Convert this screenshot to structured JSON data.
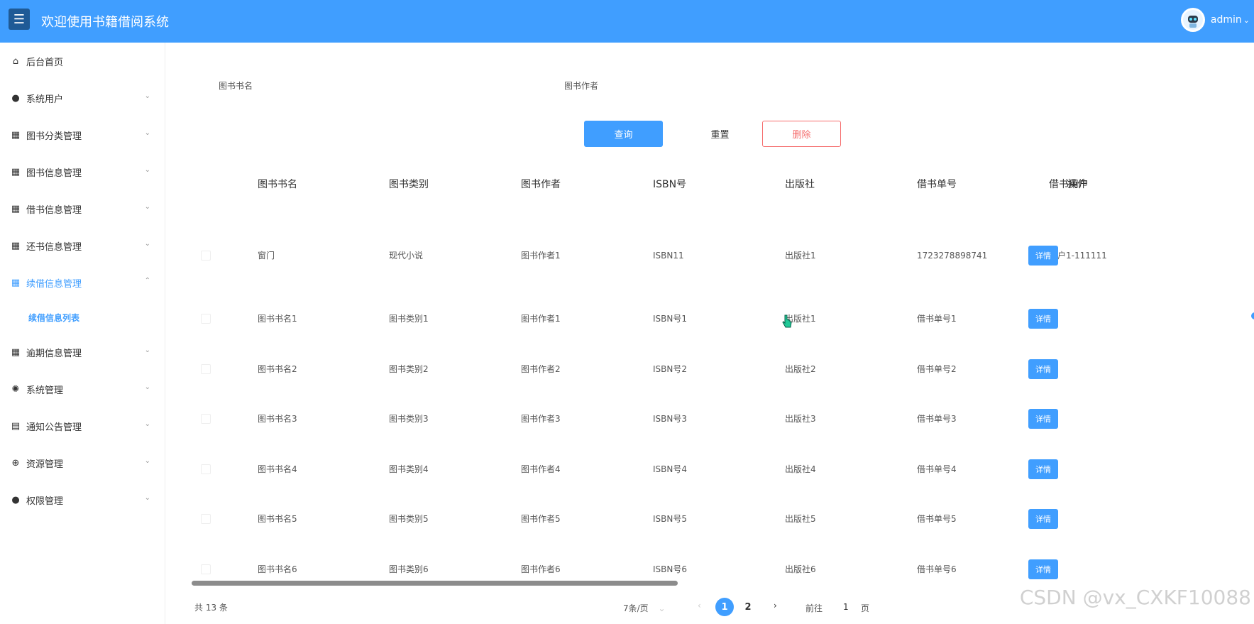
{
  "header": {
    "menu_icon": "☰",
    "title": "欢迎使用书籍借阅系统",
    "user": "admin",
    "user_caret": "⌄"
  },
  "sidebar": {
    "items": [
      {
        "label": "后台首页",
        "icon": "home-icon",
        "glyph": "⌂"
      },
      {
        "label": "系统用户",
        "icon": "user-icon",
        "glyph": "●",
        "chevron": "⌄"
      },
      {
        "label": "图书分类管理",
        "icon": "grid-icon",
        "glyph": "▦",
        "chevron": "⌄"
      },
      {
        "label": "图书信息管理",
        "icon": "grid-icon",
        "glyph": "▦",
        "chevron": "⌄"
      },
      {
        "label": "借书信息管理",
        "icon": "grid-icon",
        "glyph": "▦",
        "chevron": "⌄"
      },
      {
        "label": "还书信息管理",
        "icon": "grid-icon",
        "glyph": "▦",
        "chevron": "⌄"
      },
      {
        "label": "续借信息管理",
        "icon": "grid-icon",
        "glyph": "▦",
        "chevron": "⌃"
      },
      {
        "label": "逾期信息管理",
        "icon": "grid-icon",
        "glyph": "▦",
        "chevron": "⌄"
      },
      {
        "label": "系统管理",
        "icon": "gear-icon",
        "glyph": "✺",
        "chevron": "⌄"
      },
      {
        "label": "通知公告管理",
        "icon": "document-icon",
        "glyph": "▤",
        "chevron": "⌄"
      },
      {
        "label": "资源管理",
        "icon": "plus-circle-icon",
        "glyph": "⊕",
        "chevron": "⌄"
      },
      {
        "label": "权限管理",
        "icon": "user-icon",
        "glyph": "●",
        "chevron": "⌄"
      }
    ],
    "active_sub": "续借信息列表"
  },
  "filters": {
    "name_label": "图书书名",
    "author_label": "图书作者"
  },
  "buttons": {
    "query": "查询",
    "reset": "重置",
    "delete": "删除"
  },
  "table": {
    "headers": [
      "图书书名",
      "图书类别",
      "图书作者",
      "ISBN号",
      "出版社",
      "借书单号",
      "借书用户",
      "操作"
    ],
    "rows": [
      [
        "窗门",
        "现代小说",
        "图书作者1",
        "ISBN11",
        "出版社1",
        "1723278898741",
        "用户1-111111"
      ],
      [
        "图书书名1",
        "图书类别1",
        "图书作者1",
        "ISBN号1",
        "出版社1",
        "借书单号1",
        ""
      ],
      [
        "图书书名2",
        "图书类别2",
        "图书作者2",
        "ISBN号2",
        "出版社2",
        "借书单号2",
        ""
      ],
      [
        "图书书名3",
        "图书类别3",
        "图书作者3",
        "ISBN号3",
        "出版社3",
        "借书单号3",
        ""
      ],
      [
        "图书书名4",
        "图书类别4",
        "图书作者4",
        "ISBN号4",
        "出版社4",
        "借书单号4",
        ""
      ],
      [
        "图书书名5",
        "图书类别5",
        "图书作者5",
        "ISBN号5",
        "出版社5",
        "借书单号5",
        ""
      ],
      [
        "图书书名6",
        "图书类别6",
        "图书作者6",
        "ISBN号6",
        "出版社6",
        "借书单号6",
        ""
      ]
    ],
    "detail_label": "详情"
  },
  "pagination": {
    "total": "共 13 条",
    "page_size": "7条/页",
    "page_size_caret": "⌄",
    "prev": "‹",
    "pages": [
      "1",
      "2"
    ],
    "next": "›",
    "goto_label": "前往",
    "goto_value": "1",
    "page_suffix": "页"
  },
  "watermark": "CSDN @vx_CXKF10088",
  "colors": {
    "primary": "#409eff",
    "danger": "#f56c6c"
  }
}
